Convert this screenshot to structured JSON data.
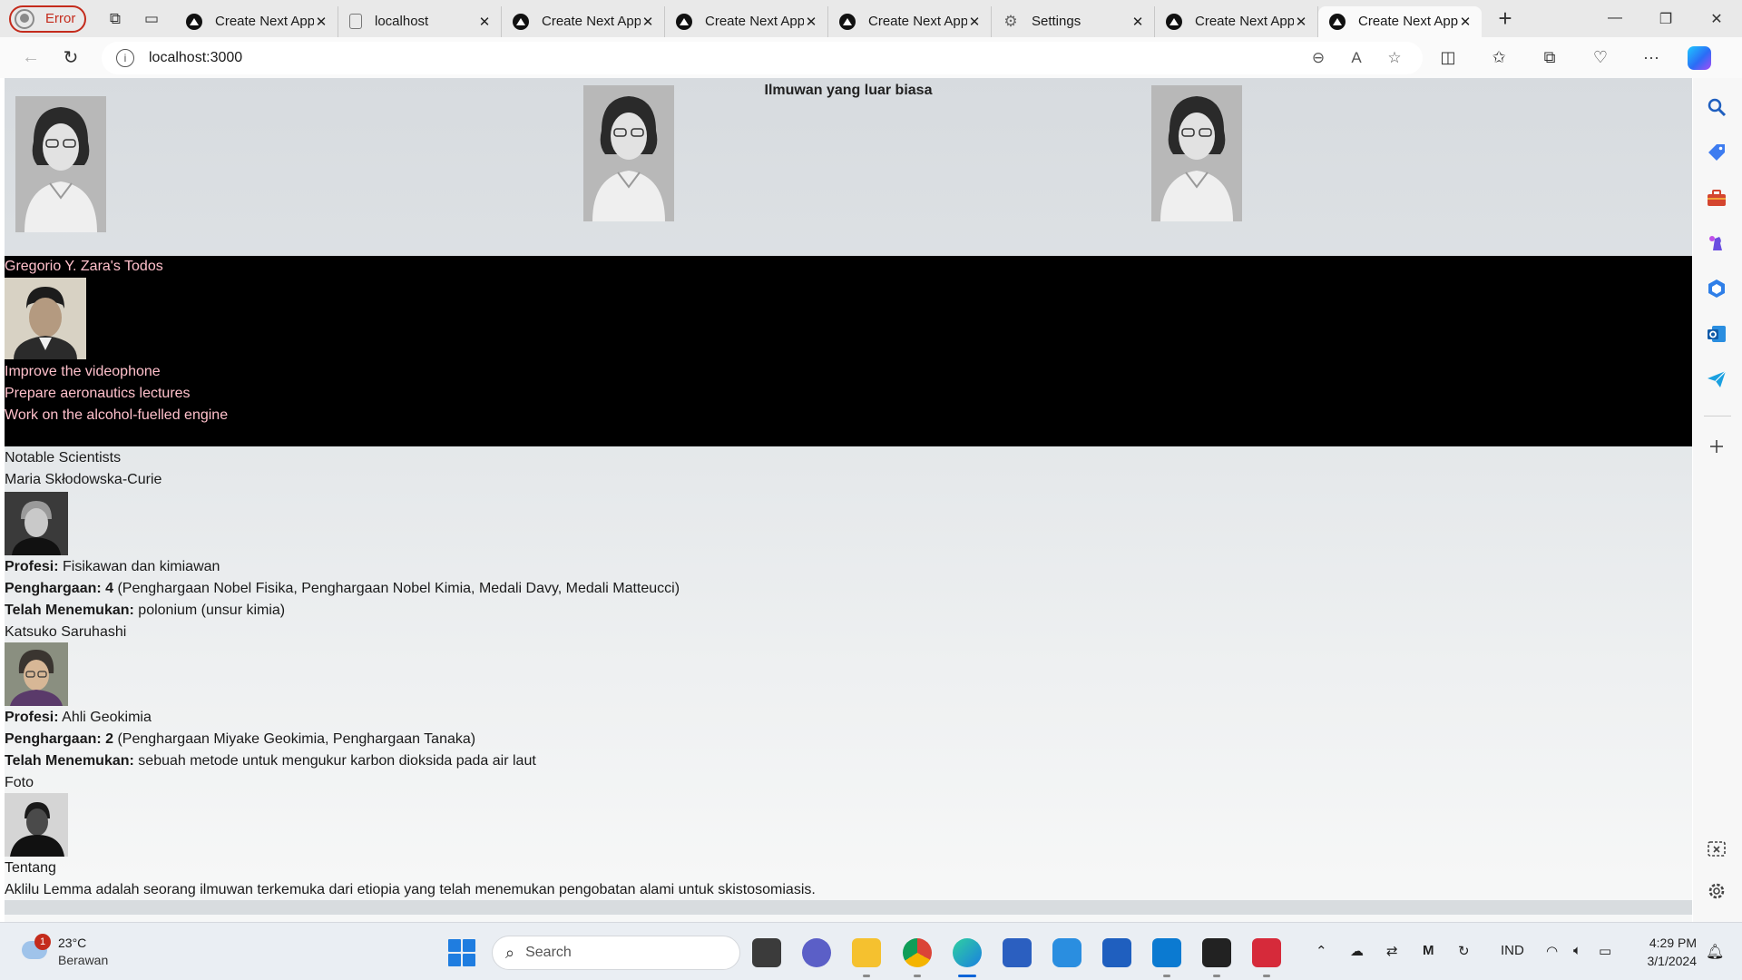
{
  "browser": {
    "profile_status": "Error",
    "tabs": [
      {
        "title": "Create Next App",
        "icon": "nextjs-icon"
      },
      {
        "title": "localhost",
        "icon": "page-icon"
      },
      {
        "title": "Create Next App",
        "icon": "nextjs-icon"
      },
      {
        "title": "Create Next App",
        "icon": "nextjs-icon"
      },
      {
        "title": "Create Next App",
        "icon": "nextjs-icon"
      },
      {
        "title": "Settings",
        "icon": "gear-icon"
      },
      {
        "title": "Create Next App",
        "icon": "nextjs-icon"
      },
      {
        "title": "Create Next App",
        "icon": "nextjs-icon",
        "active": true
      }
    ],
    "address": "localhost:3000"
  },
  "page": {
    "gallery_title": "Ilmuwan yang luar biasa",
    "todos": {
      "title": "Gregorio Y. Zara's Todos",
      "items": [
        "Improve the videophone",
        "Prepare aeronautics lectures",
        "Work on the alcohol-fuelled engine"
      ]
    },
    "section_title": "Notable Scientists",
    "scientists": [
      {
        "name": "Maria Skłodowska-Curie",
        "profession_label": "Profesi:",
        "profession": " Fisikawan dan kimiawan",
        "awards_label": "Penghargaan: 4",
        "awards": " (Penghargaan Nobel Fisika, Penghargaan Nobel Kimia, Medali Davy, Medali Matteucci)",
        "discovered_label": "Telah Menemukan:",
        "discovered": " polonium (unsur kimia)"
      },
      {
        "name": "Katsuko Saruhashi",
        "profession_label": "Profesi:",
        "profession": " Ahli Geokimia",
        "awards_label": "Penghargaan: 2",
        "awards": " (Penghargaan Miyake Geokimia, Penghargaan Tanaka)",
        "discovered_label": "Telah Menemukan:",
        "discovered": " sebuah metode untuk mengukur karbon dioksida pada air laut"
      }
    ],
    "card": {
      "photo_label": "Foto",
      "about_label": "Tentang",
      "about_text": "Aklilu Lemma adalah seorang ilmuwan terkemuka dari etiopia yang telah menemukan pengobatan alami untuk skistosomiasis."
    }
  },
  "taskbar": {
    "weather_temp": "23°C",
    "weather_condition": "Berawan",
    "weather_badge": "1",
    "search_placeholder": "Search",
    "language": "IND",
    "time": "4:29 PM",
    "date": "3/1/2024"
  },
  "colors": {
    "todo_text": "pink",
    "todo_bg": "#000000",
    "error": "#c42b1c",
    "accent": "#0a64d8"
  }
}
